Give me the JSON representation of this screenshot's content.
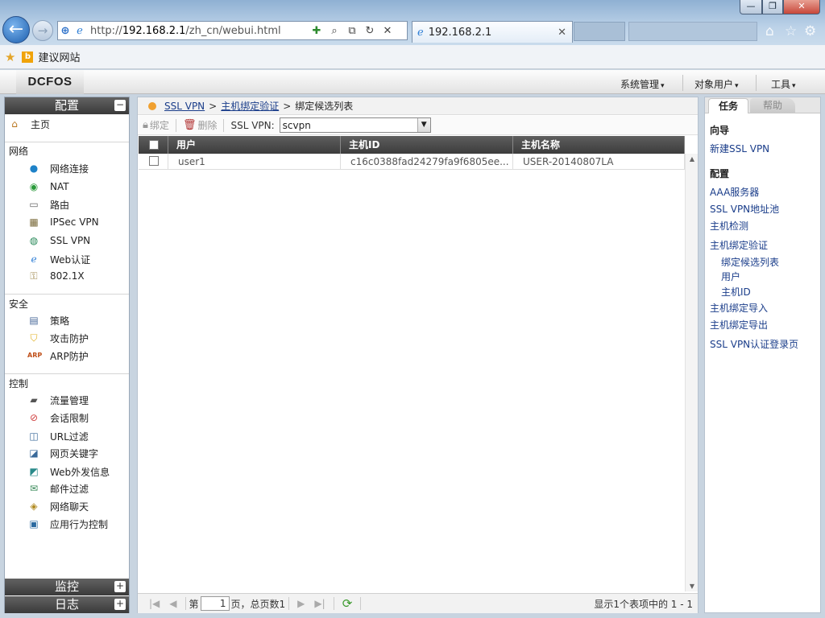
{
  "browser": {
    "window_buttons": {
      "minimize": "—",
      "maximize": "❐",
      "close": "✕"
    },
    "url_prefix": "http://",
    "url_host": "192.168.2.1",
    "url_path": "/zh_cn/webui.html",
    "tab_title": "192.168.2.1",
    "favorites_link": "建议网站"
  },
  "app": {
    "logo": "DCFOS",
    "top_menu": [
      "系统管理",
      "对象用户",
      "工具"
    ]
  },
  "nav": {
    "config_title": "配置",
    "config_toggle": "−",
    "home": "主页",
    "groups": [
      {
        "title": "网络",
        "items": [
          "网络连接",
          "NAT",
          "路由",
          "IPSec VPN",
          "SSL VPN",
          "Web认证",
          "802.1X"
        ]
      },
      {
        "title": "安全",
        "items": [
          "策略",
          "攻击防护",
          "ARP防护"
        ]
      },
      {
        "title": "控制",
        "items": [
          "流量管理",
          "会话限制",
          "URL过滤",
          "网页关键字",
          "Web外发信息",
          "邮件过滤",
          "网络聊天",
          "应用行为控制"
        ]
      }
    ],
    "monitor_title": "监控",
    "log_title": "日志",
    "expand_symbol": "+"
  },
  "breadcrumb": {
    "link1": "SSL VPN",
    "link2": "主机绑定验证",
    "current": "绑定候选列表",
    "separator": ">"
  },
  "toolbar": {
    "bind": "绑定",
    "delete": "删除",
    "ssl_vpn_label": "SSL VPN:",
    "ssl_vpn_value": "scvpn"
  },
  "table": {
    "columns": [
      "用户",
      "主机ID",
      "主机名称"
    ],
    "rows": [
      {
        "user": "user1",
        "host_id": "c16c0388fad24279fa9f6805ee...",
        "host_name": "USER-20140807LA"
      }
    ]
  },
  "pager": {
    "page_prefix": "第",
    "page_value": "1",
    "page_suffix": "页，总页数1",
    "status": "显示1个表项中的 1 - 1"
  },
  "right_panel": {
    "tabs": [
      "任务",
      "帮助"
    ],
    "wizard_title": "向导",
    "wizard_link": "新建SSL VPN",
    "config_title": "配置",
    "links": [
      "AAA服务器",
      "SSL VPN地址池",
      "主机检测",
      "主机绑定验证"
    ],
    "sub_links": [
      "绑定候选列表",
      "用户",
      "主机ID"
    ],
    "links_after": [
      "主机绑定导入",
      "主机绑定导出"
    ],
    "last_link": "SSL VPN认证登录页"
  },
  "colors": {
    "accent_orange": "#f0a030",
    "link_blue": "#1a3d8a",
    "header_dark": "#3c3c3c"
  }
}
